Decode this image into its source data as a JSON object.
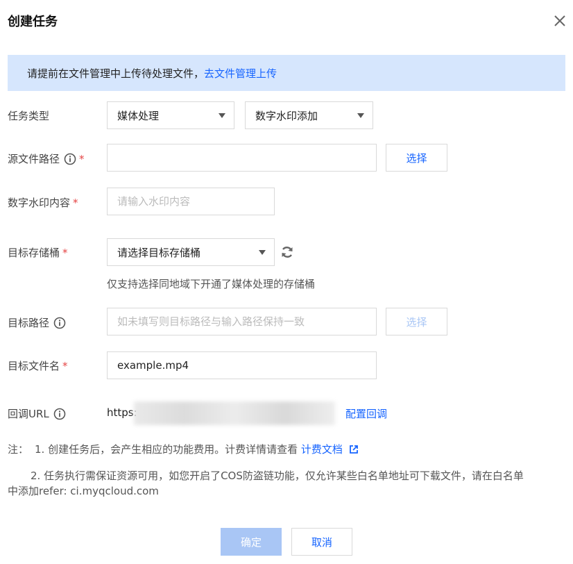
{
  "dialog": {
    "title": "创建任务"
  },
  "notice": {
    "text": "请提前在文件管理中上传待处理文件，",
    "link": "去文件管理上传"
  },
  "form": {
    "task_type": {
      "label": "任务类型",
      "primary_value": "媒体处理",
      "secondary_value": "数字水印添加"
    },
    "source_path": {
      "label": "源文件路径",
      "value": "",
      "button": "选择"
    },
    "watermark": {
      "label": "数字水印内容",
      "placeholder": "请输入水印内容"
    },
    "target_bucket": {
      "label": "目标存储桶",
      "placeholder": "请选择目标存储桶",
      "hint": "仅支持选择同地域下开通了媒体处理的存储桶"
    },
    "target_path": {
      "label": "目标路径",
      "placeholder": "如未填写则目标路径与输入路径保持一致",
      "button": "选择"
    },
    "target_filename": {
      "label": "目标文件名",
      "value": "example.mp4"
    },
    "callback": {
      "label": "回调URL",
      "prefix": "https:",
      "link": "配置回调"
    },
    "required_mark": "*"
  },
  "notes": {
    "prefix": "注：",
    "line1": "1. 创建任务后，会产生相应的功能费用。计费详情请查看",
    "line1_link": "计费文档",
    "line2a": "2. 任务执行需保证资源可用，如您开启了COS防盗链功能，仅允许某些白名单地址可下载文件，请在白名单",
    "line2b": "中添加refer: ci.myqcloud.com"
  },
  "footer": {
    "ok": "确定",
    "cancel": "取消"
  },
  "colors": {
    "accent": "#1664ff",
    "notice_bg": "#d6e6fd",
    "required": "#e54545",
    "disabled_btn": "#a9c6f5"
  }
}
